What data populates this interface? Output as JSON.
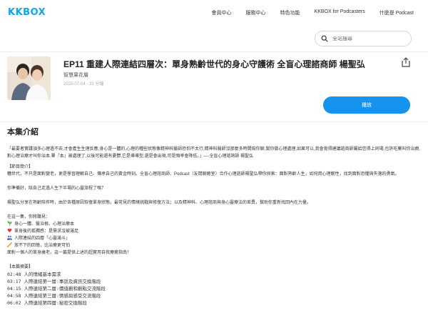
{
  "header": {
    "logo": "KKBOX",
    "nav": [
      "會員中心",
      "服務中心",
      "特色功能",
      "KKBOX for Podcasters",
      "什麼是 Podcast"
    ]
  },
  "search": {
    "placeholder": "全站搜尋"
  },
  "episode": {
    "title": "EP11 重建人際連結四層次：單身熟齡世代的身心守護術 全盲心理諮商師 楊聖弘",
    "podcast": "智慧果花層",
    "meta": "2025-07-04 · 33 分鐘",
    "play_label": "播放"
  },
  "section_title": "本集介紹",
  "description": {
    "quote": "「最要者實踐須多心理過不去,才會產生生理反應,身心是一體的,心理的種些狀態像精神科醫師恐怕不太行,精神科醫師沒那麼多時間陪你聊,幫你做心理處理,如果可以,我會覺得建議諮商師屬給您得上同場,也許吃藥叫你治療,對心理治療才叫你治本,畢『本』被處理了,以後可能還有憂鬱,它是導導型,還是會出現,可是頻率會降低。」----全盲心理諮詢師 楊聖弘",
    "guide_header": "【節目簡介】",
    "guide_body": "糟世代，不只是面對變老，更是學習理解自己、傳承自己的黃金時刻。全盲心理諮商師、Podcast（友閒聊癒室）合作心理諮師楊聖弘帶你探索：面對熟齡人生，如何用心理韌性，找到面對恐懼與失落的勇氣。",
    "question": "你準備好，陪自己走過人生下半場的心靈旅程了嗎？",
    "intro": "楊聖弘分享在熟齡陪伴時，由於各種原因恢復單身狀態，最常見的情緒挑戰與修復方法；以及精神科、心理諮商與身心靈療法的差異，幫助你重新找回內在力量。",
    "list_header": "在這一集，你將聽見：",
    "list_items": [
      {
        "icon": "herb-icon",
        "color": "#4caf50",
        "text": "身心一體、醫治根、心理治療本"
      },
      {
        "icon": "heart-icon",
        "color": "#e53935",
        "text": "單身後的孤獨感：是需求沒被滿足"
      },
      {
        "icon": "people-icon",
        "color": "#5c6bc0",
        "text": "人際連結的四層「心靈滿斗」"
      },
      {
        "icon": "note-icon",
        "color": "#e6a100",
        "text": "放不下的回憶，比治療更可怕"
      }
    ],
    "list_tail": "面對一個人的單身歲老，這一篇提供上述的超實用自我療癒指南！",
    "chapters_header": "【本篇摘要】",
    "chapters": [
      "02:48 人的情緒基本需求",
      "03:17 人際連結第一層:事話及資訊交換階段",
      "04:15 人際連結第二層:價值觀和觀點交流階段",
      "04:58 人際連結第三層:情感與感受交流階段",
      "06:02 人際連結第四層:秘密交換階段"
    ]
  }
}
